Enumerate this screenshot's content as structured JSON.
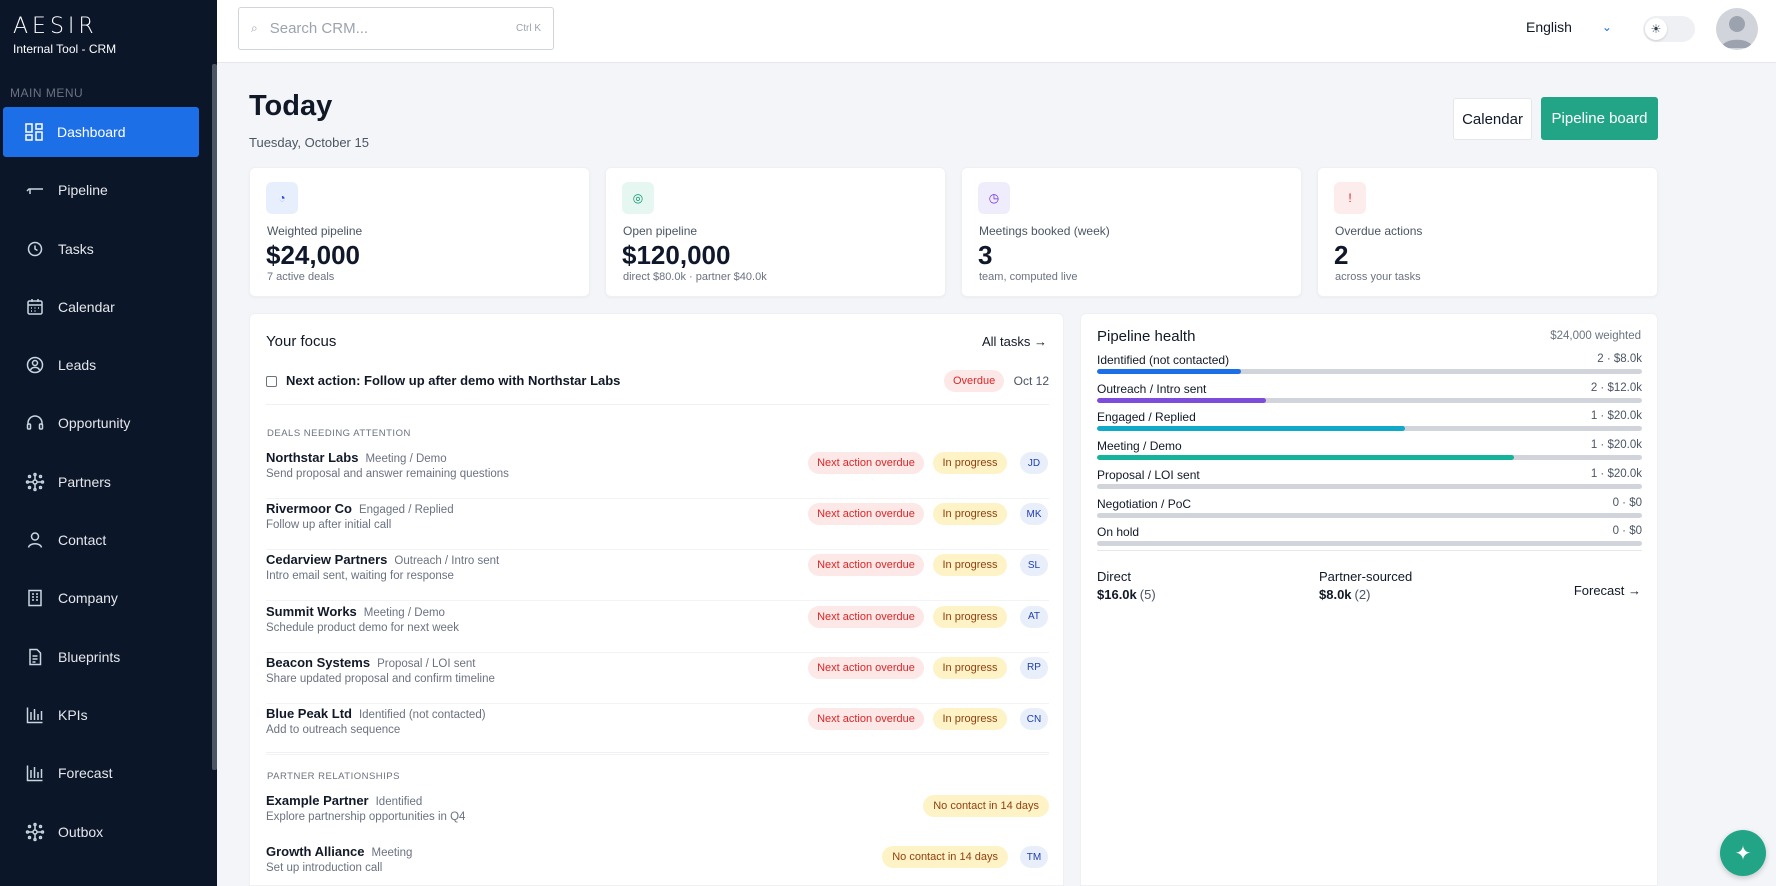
{
  "app": {
    "logo": "AESIR",
    "subtitle": "Internal Tool - CRM"
  },
  "sidebar": {
    "menu_title": "MAIN MENU",
    "items": [
      {
        "label": "Dashboard",
        "icon": "dashboard-icon",
        "active": true
      },
      {
        "label": "Pipeline",
        "icon": "pipeline-icon"
      },
      {
        "label": "Tasks",
        "icon": "clock-icon"
      },
      {
        "label": "Calendar",
        "icon": "calendar-icon"
      },
      {
        "label": "Leads",
        "icon": "user-circle-icon"
      },
      {
        "label": "Opportunity",
        "icon": "headset-icon"
      },
      {
        "label": "Partners",
        "icon": "network-icon"
      },
      {
        "label": "Contact",
        "icon": "person-icon"
      },
      {
        "label": "Company",
        "icon": "building-icon"
      },
      {
        "label": "Blueprints",
        "icon": "document-icon"
      },
      {
        "label": "KPIs",
        "icon": "bar-chart-icon"
      },
      {
        "label": "Forecast",
        "icon": "bar-chart-icon"
      },
      {
        "label": "Outbox",
        "icon": "network-icon"
      }
    ]
  },
  "topbar": {
    "search_placeholder": "Search CRM...",
    "search_shortcut": "Ctrl K",
    "language": "English"
  },
  "header": {
    "title": "Today",
    "date": "Tuesday, October 15",
    "calendar_button": "Calendar",
    "pipeline_button": "Pipeline board"
  },
  "kpis": [
    {
      "label": "Weighted pipeline",
      "value": "$24,000",
      "sub": "7 active deals",
      "icon": "pie-icon",
      "icon_bg": "#e8effc",
      "icon_color": "#1d4ed8"
    },
    {
      "label": "Open pipeline",
      "value": "$120,000",
      "sub": "direct $80.0k · partner $40.0k",
      "icon": "target-icon",
      "icon_bg": "#e6f6f1",
      "icon_color": "#059669"
    },
    {
      "label": "Meetings booked (week)",
      "value": "3",
      "sub": "team, computed live",
      "icon": "clock-icon",
      "icon_bg": "#efedfb",
      "icon_color": "#6d28d9"
    },
    {
      "label": "Overdue actions",
      "value": "2",
      "sub": "across your tasks",
      "icon": "alert-icon",
      "icon_bg": "#fdecec",
      "icon_color": "#dc2626"
    }
  ],
  "focus": {
    "title": "Your focus",
    "all_tasks": "All tasks →",
    "task": {
      "text": "Next action: Follow up after demo with Northstar Labs",
      "badge": "Overdue",
      "date": "Oct 12"
    },
    "deals_label": "DEALS NEEDING ATTENTION",
    "deals": [
      {
        "name": "Northstar Labs",
        "stage": "Meeting / Demo",
        "desc": "Send proposal and answer remaining questions",
        "alert": "Next action overdue",
        "status": "In progress",
        "owner": "JD"
      },
      {
        "name": "Rivermoor Co",
        "stage": "Engaged / Replied",
        "desc": "Follow up after initial call",
        "alert": "Next action overdue",
        "status": "In progress",
        "owner": "MK"
      },
      {
        "name": "Cedarview Partners",
        "stage": "Outreach / Intro sent",
        "desc": "Intro email sent, waiting for response",
        "alert": "Next action overdue",
        "status": "In progress",
        "owner": "SL"
      },
      {
        "name": "Summit Works",
        "stage": "Meeting / Demo",
        "desc": "Schedule product demo for next week",
        "alert": "Next action overdue",
        "status": "In progress",
        "owner": "AT"
      },
      {
        "name": "Beacon Systems",
        "stage": "Proposal / LOI sent",
        "desc": "Share updated proposal and confirm timeline",
        "alert": "Next action overdue",
        "status": "In progress",
        "owner": "RP"
      },
      {
        "name": "Blue Peak Ltd",
        "stage": "Identified (not contacted)",
        "desc": "Add to outreach sequence",
        "alert": "Next action overdue",
        "status": "In progress",
        "owner": "CN"
      }
    ],
    "partners_label": "PARTNER RELATIONSHIPS",
    "partners": [
      {
        "name": "Example Partner",
        "stage": "Identified",
        "desc": "Explore partnership opportunities in Q4",
        "alert": "No contact in 14 days",
        "owner": ""
      },
      {
        "name": "Growth Alliance",
        "stage": "Meeting",
        "desc": "Set up introduction call",
        "alert": "No contact in 14 days",
        "owner": "TM"
      }
    ]
  },
  "health": {
    "title": "Pipeline health",
    "weighted": "$24,000 weighted",
    "stages": [
      {
        "name": "Identified (not contacted)",
        "meta": "2 · $8.0k",
        "fill": 0.265,
        "color": "#1d6fe8"
      },
      {
        "name": "Outreach / Intro sent",
        "meta": "2 · $12.0k",
        "fill": 0.31,
        "color": "#7c4ddb"
      },
      {
        "name": "Engaged / Replied",
        "meta": "1 · $20.0k",
        "fill": 0.565,
        "color": "#10aac8"
      },
      {
        "name": "Meeting / Demo",
        "meta": "1 · $20.0k",
        "fill": 0.765,
        "color": "#14b39a"
      },
      {
        "name": "Proposal / LOI sent",
        "meta": "1 · $20.0k",
        "fill": 0,
        "color": "#f59e0b"
      },
      {
        "name": "Negotiation / PoC",
        "meta": "0 · $0",
        "fill": 0,
        "color": "#f59e0b"
      },
      {
        "name": "On hold",
        "meta": "0 · $0",
        "fill": 0,
        "color": "#9ca3af"
      }
    ],
    "direct_label": "Direct",
    "direct_value": "$16.0k",
    "direct_count": "(5)",
    "partner_label": "Partner-sourced",
    "partner_value": "$8.0k",
    "partner_count": "(2)",
    "forecast_link": "Forecast →"
  }
}
